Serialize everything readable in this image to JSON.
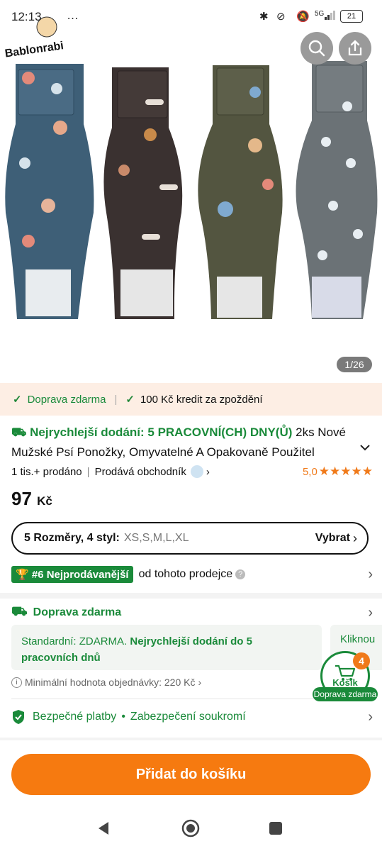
{
  "status_bar": {
    "time": "12:13",
    "notif_icons": "…",
    "network": "5G",
    "battery": "21"
  },
  "hero": {
    "watermark_text": "Bablonrabi",
    "image_counter": "1/26",
    "colors": [
      "#3e5f77",
      "#3a3130",
      "#535540",
      "#6b7276"
    ]
  },
  "shipping_banner": {
    "item1": "Doprava zdarma",
    "separator": "|",
    "item2": "100 Kč kredit za zpoždění"
  },
  "product": {
    "fast_delivery": "Nejrychlejší dodání: 5 PRACOVNÍ(CH) DNY(Ů)",
    "title_line1": "2ks Nové",
    "title_line2": "Mužské Psí Ponožky, Omyvatelné A Opakovaně Použitel",
    "sold": "1 tis.+ prodáno",
    "seller": "Prodává obchodník",
    "rating": "5,0",
    "stars": "★★★★★",
    "price_value": "97",
    "price_currency": "Kč"
  },
  "variant": {
    "label": "5 Rozměry, 4 styl:",
    "options": "XS,S,M,L,XL",
    "action": "Vybrat"
  },
  "bestseller": {
    "badge": "#6 Nejprodávanější",
    "text": "od tohoto prodejce"
  },
  "delivery": {
    "title": "Doprava zdarma",
    "standard_prefix": "Standardní: ZDARMA.",
    "standard_bold": "Nejrychlejší dodání do 5 pracovních dnů",
    "next_card": "Kliknou",
    "min_order": "Minimální hodnota objednávky: 220 Kč"
  },
  "security": {
    "payments": "Bezpečné platby",
    "dot": "•",
    "privacy": "Zabezpečení soukromí"
  },
  "cart_float": {
    "count": "4",
    "label": "Košík",
    "free_shipping": "Doprava zdarma"
  },
  "bottom": {
    "add_to_cart": "Přidat do košíku"
  },
  "colors": {
    "accent_orange": "#f67a10",
    "accent_green": "#1a8a3a"
  }
}
